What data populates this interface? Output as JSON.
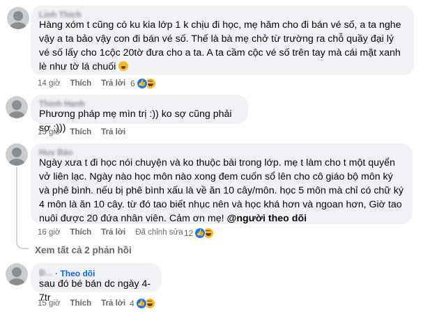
{
  "comments": [
    {
      "author": "Linh Thích",
      "text": "Hàng xóm t cũng có ku kia lớp 1 k chịu đi học, mẹ hăm cho đi bán vé số, a ta nghe vậy a ta bảo vậy con đi bán vé số. Thế là bà mẹ chở từ trường ra chỗ quầy đại lý vé số lấy cho 1cộc 20tờ đưa cho a ta. A ta cầm cộc vé số trên tay mà cái mặt xanh lè như tờ lá chuối",
      "time": "14 giờ",
      "like": "Thích",
      "reply": "Trả lời",
      "reactions": "6"
    },
    {
      "author": "Thịnh Hạnh",
      "text": "Phương pháp mẹ mìn trị :)) ko sợ cũng phải sợ :)))",
      "time": "15 giờ",
      "like": "Thích",
      "reply": "Trả lời",
      "reactions": ""
    },
    {
      "author": "Huy Bảo",
      "text_before": "Ngày xưa t đi học nói chuyện và ko thuộc bài trong lớp. mẹ t làm cho t một quyển vở liên lạc. Ngày nào học môn nào xong đem cuốn sổ lên cho cô giáo bộ môn ký và phê bình. nếu bị phê bình xấu là về ăn 10 cây/môn. học 5 môn mà chỉ có chữ ký 4 môn là ăn 10 cây. từ đó tao biết nhục nên và học khá hơn và ngoan hơn, Giờ tao nuôi được 20 đứa nhân viên. Cảm ơn mẹ! ",
      "mention": "@người theo dõi",
      "time": "16 giờ",
      "like": "Thích",
      "reply": "Trả lời",
      "edited": "Đã chỉnh sửa",
      "reactions": "12"
    },
    {
      "author": "Đ...",
      "follow": "· Theo dõi",
      "text": "sau đó bé bán dc ngày 4-7tr",
      "time": "15 giờ",
      "like": "Thích",
      "reply": "Trả lời",
      "reactions": "4"
    }
  ],
  "view_replies": "Xem tất cả 2 phản hồi",
  "colors": {
    "bubble": "#f0f2f5",
    "like": "#1877f2",
    "haha": "#f7b928",
    "link": "#0866ff",
    "meta": "#65676b"
  }
}
